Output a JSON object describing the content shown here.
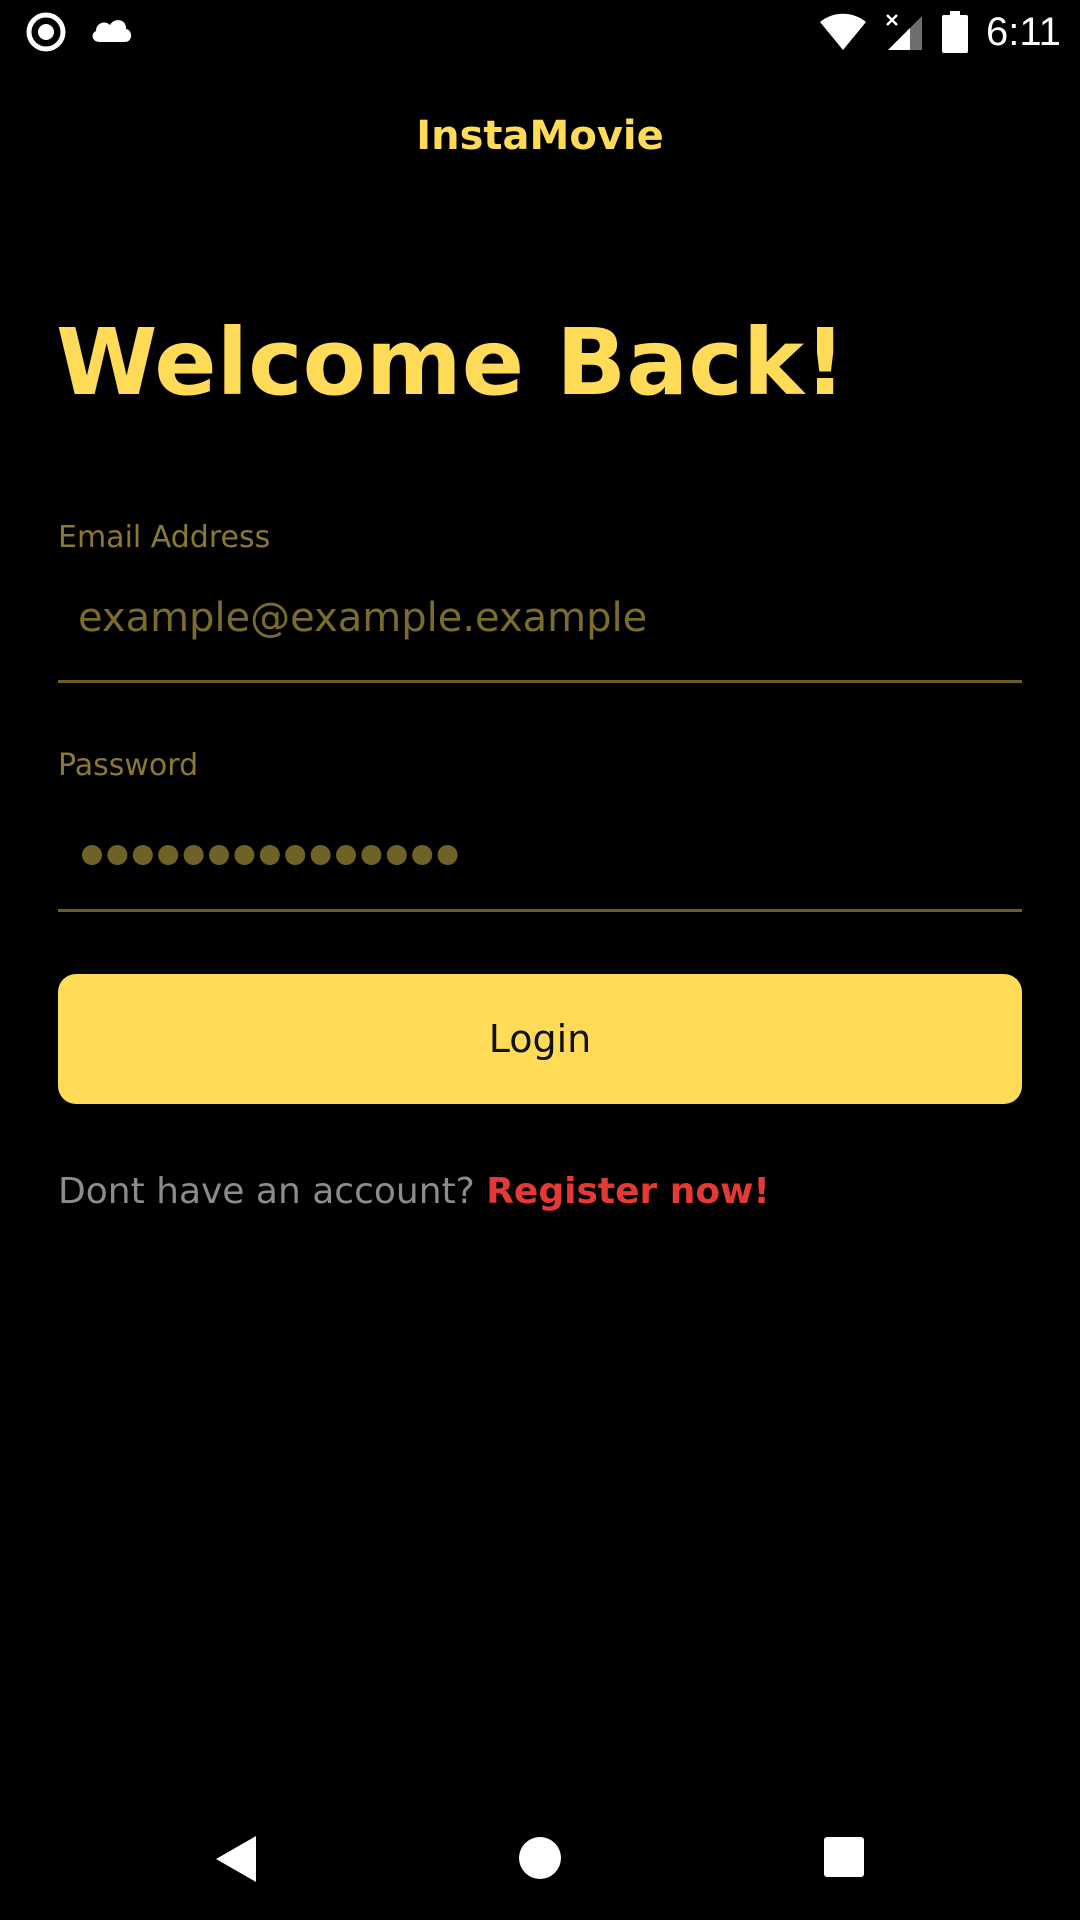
{
  "status_bar": {
    "time": "6:11",
    "left_icons": [
      "record-icon",
      "cloud-icon"
    ],
    "right_icons": [
      "wifi-icon",
      "signal-icon",
      "battery-icon"
    ]
  },
  "app_bar": {
    "title": "InstaMovie"
  },
  "login": {
    "heading": "Welcome Back!",
    "email_label": "Email Address",
    "email_placeholder": "example@example.example",
    "password_label": "Password",
    "password_mask_count": 15,
    "login_button": "Login",
    "register_prompt": "Dont have an account?",
    "register_link": "Register now!"
  },
  "nav_bar": {
    "buttons": [
      "back-icon",
      "home-icon",
      "recents-icon"
    ]
  },
  "colors": {
    "background": "#000000",
    "accent": "#ffdb58",
    "muted_accent": "#8a7a30",
    "link": "#e53935",
    "secondary_text": "#8c8c8c"
  }
}
